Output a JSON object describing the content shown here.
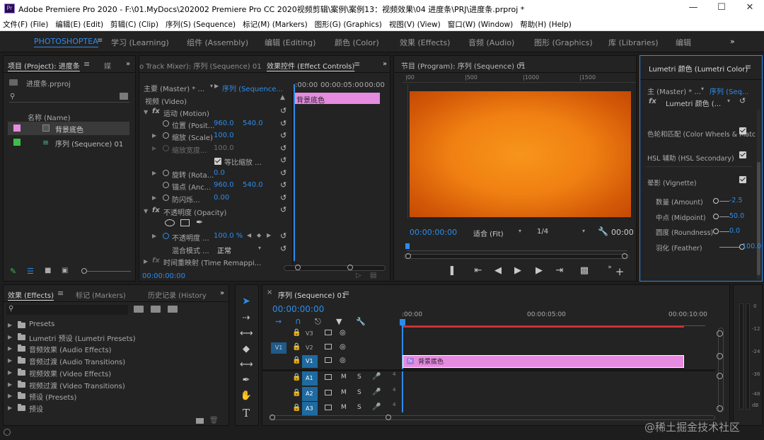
{
  "titlebar": {
    "app_icon": "Pr",
    "title": "Adobe Premiere Pro 2020 - F:\\01.MyDocs\\202002 Premiere Pro CC 2020视频剪辑\\案例\\案例13：视频效果\\04 进度条\\PRJ\\进度条.prproj *"
  },
  "menu": [
    "文件(F) (File)",
    "编辑(E) (Edit)",
    "剪辑(C) (Clip)",
    "序列(S) (Sequence)",
    "标记(M) (Markers)",
    "图形(G) (Graphics)",
    "视图(V) (View)",
    "窗口(W) (Window)",
    "帮助(H) (Help)"
  ],
  "workspaces": {
    "active": "PHOTOSHOPTEA",
    "items": [
      "学习 (Learning)",
      "组件 (Assembly)",
      "编辑 (Editing)",
      "颜色 (Color)",
      "效果 (Effects)",
      "音频 (Audio)",
      "图形 (Graphics)",
      "库 (Libraries)",
      "编辑"
    ],
    "more": "»"
  },
  "project_panel": {
    "tab": "项目 (Project): 进度条",
    "tab2": "媒",
    "filename": "进度条.prproj",
    "column_name": "名称 (Name)",
    "items": [
      {
        "name": "背景底色",
        "color": "#e58be0"
      },
      {
        "name": "序列 (Sequence) 01",
        "color": "#3bbf48"
      }
    ]
  },
  "effect_controls": {
    "tab_mixer": "o Track Mixer): 序列 (Sequence) 01",
    "tab": "效果控件 (Effect Controls)",
    "master": "主要 (Master) * ...",
    "sequence": "序列 (Sequence...",
    "timecodes": [
      ":00:00",
      "00:00:05:00",
      "00:00"
    ],
    "clip_label": "背景底色",
    "video_header": "视频 (Video)",
    "motion": "运动 (Motion)",
    "position_label": "位置 (Posit...",
    "position_x": "960.0",
    "position_y": "540.0",
    "scale_label": "缩放 (Scale)",
    "scale_value": "100.0",
    "scale_width_label": "缩放宽度...",
    "scale_width_value": "100.0",
    "uniform_scale": "等比缩放 ...",
    "rotation_label": "旋转 (Rota...",
    "rotation_value": "0.0",
    "anchor_label": "锚点 (Anc...",
    "anchor_x": "960.0",
    "anchor_y": "540.0",
    "antiflicker_label": "防闪烁...",
    "antiflicker_value": "0.00",
    "opacity_header": "不透明度 (Opacity)",
    "opacity_label": "不透明度 ...",
    "opacity_value": "100.0 %",
    "blend_label": "混合模式 ...",
    "blend_value": "正常",
    "time_remap": "时间重映射 (Time Remappi...",
    "footer_time": "00:00:00:00"
  },
  "program_monitor": {
    "tab": "节目 (Program): 序列 (Sequence) 01",
    "ruler_marks": [
      "|00",
      "|500",
      "|1000",
      "|1500"
    ],
    "timecode": "00:00:00:00",
    "fit": "适合 (Fit)",
    "quality": "1/4",
    "right_time": "00:00",
    "frame_color_center": "#f58a14",
    "frame_color_edge": "#c44a05"
  },
  "lumetri": {
    "tab": "Lumetri 颜色 (Lumetri Color)",
    "master": "主 (Master) * ...",
    "sequence": "序列 (Seq...",
    "effect": "Lumetri 颜色 (...",
    "sections": [
      {
        "label": "色轮和匹配 (Color Wheels & Matc",
        "checked": true
      },
      {
        "label": "HSL 辅助 (HSL Secondary)",
        "checked": true
      },
      {
        "label": "晕影 (Vignette)",
        "checked": true
      }
    ],
    "sliders": [
      {
        "label": "数量 (Amount)",
        "value": "-2.5",
        "level": 0.0
      },
      {
        "label": "中点 (Midpoint)",
        "value": "50.0",
        "level": 0.5
      },
      {
        "label": "圆度 (Roundness)",
        "value": "0.0",
        "level": 0.5
      },
      {
        "label": "羽化 (Feather)",
        "value": "100.0",
        "level": 1.0
      }
    ]
  },
  "effects_panel": {
    "tabs": [
      "效果 (Effects)",
      "标记 (Markers)",
      "历史记录 (History"
    ],
    "more": "»",
    "items": [
      "Presets",
      "Lumetri 预设 (Lumetri Presets)",
      "音频效果 (Audio Effects)",
      "音频过渡 (Audio Transitions)",
      "视频效果 (Video Effects)",
      "视频过渡 (Video Transitions)",
      "预设 (Presets)",
      "预设"
    ]
  },
  "timeline": {
    "tab": "序列 (Sequence) 01",
    "timecode": "00:00:00:00",
    "ruler": [
      ":00:00",
      "00:00:05:00",
      "00:00:10:00"
    ],
    "video_tracks": [
      "V3",
      "V2",
      "V1"
    ],
    "audio_tracks": [
      "A1",
      "A2",
      "A3"
    ],
    "source_patch": [
      "V1",
      "A1",
      "A2",
      "A3"
    ],
    "clip_label": "背景底色",
    "clip_fx": "fx",
    "track_letters": [
      "M",
      "S"
    ],
    "audio_level": "4"
  },
  "meter": {
    "labels": [
      "0",
      "-12",
      "-24",
      "-36",
      "-48",
      "dB"
    ]
  },
  "watermark": "@稀土掘金技术社区"
}
